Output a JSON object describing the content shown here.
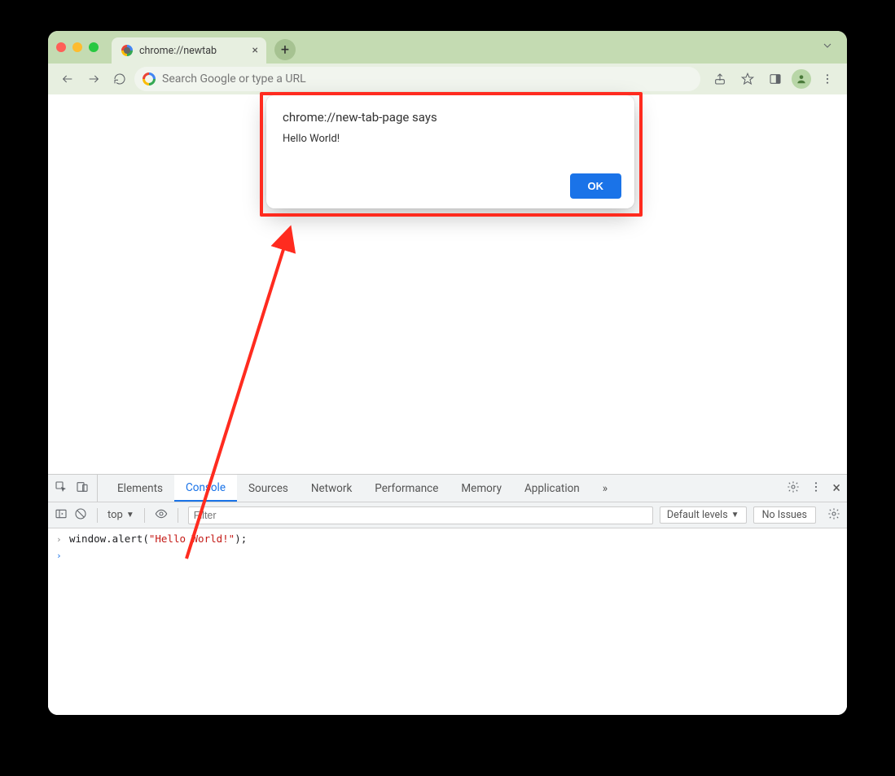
{
  "browser": {
    "tab_title": "chrome://newtab",
    "omnibox_placeholder": "Search Google or type a URL"
  },
  "dialog": {
    "title": "chrome://new-tab-page says",
    "message": "Hello World!",
    "ok_label": "OK"
  },
  "devtools": {
    "tabs": [
      "Elements",
      "Console",
      "Sources",
      "Network",
      "Performance",
      "Memory",
      "Application"
    ],
    "active_tab": "Console",
    "context": "top",
    "filter_placeholder": "Filter",
    "levels_label": "Default levels",
    "issues_label": "No Issues",
    "console_code": {
      "fn": "window.alert",
      "open": "(",
      "str": "\"Hello World!\"",
      "close": ");"
    }
  },
  "annotation": {
    "arrow_color": "#ff2b1f"
  }
}
